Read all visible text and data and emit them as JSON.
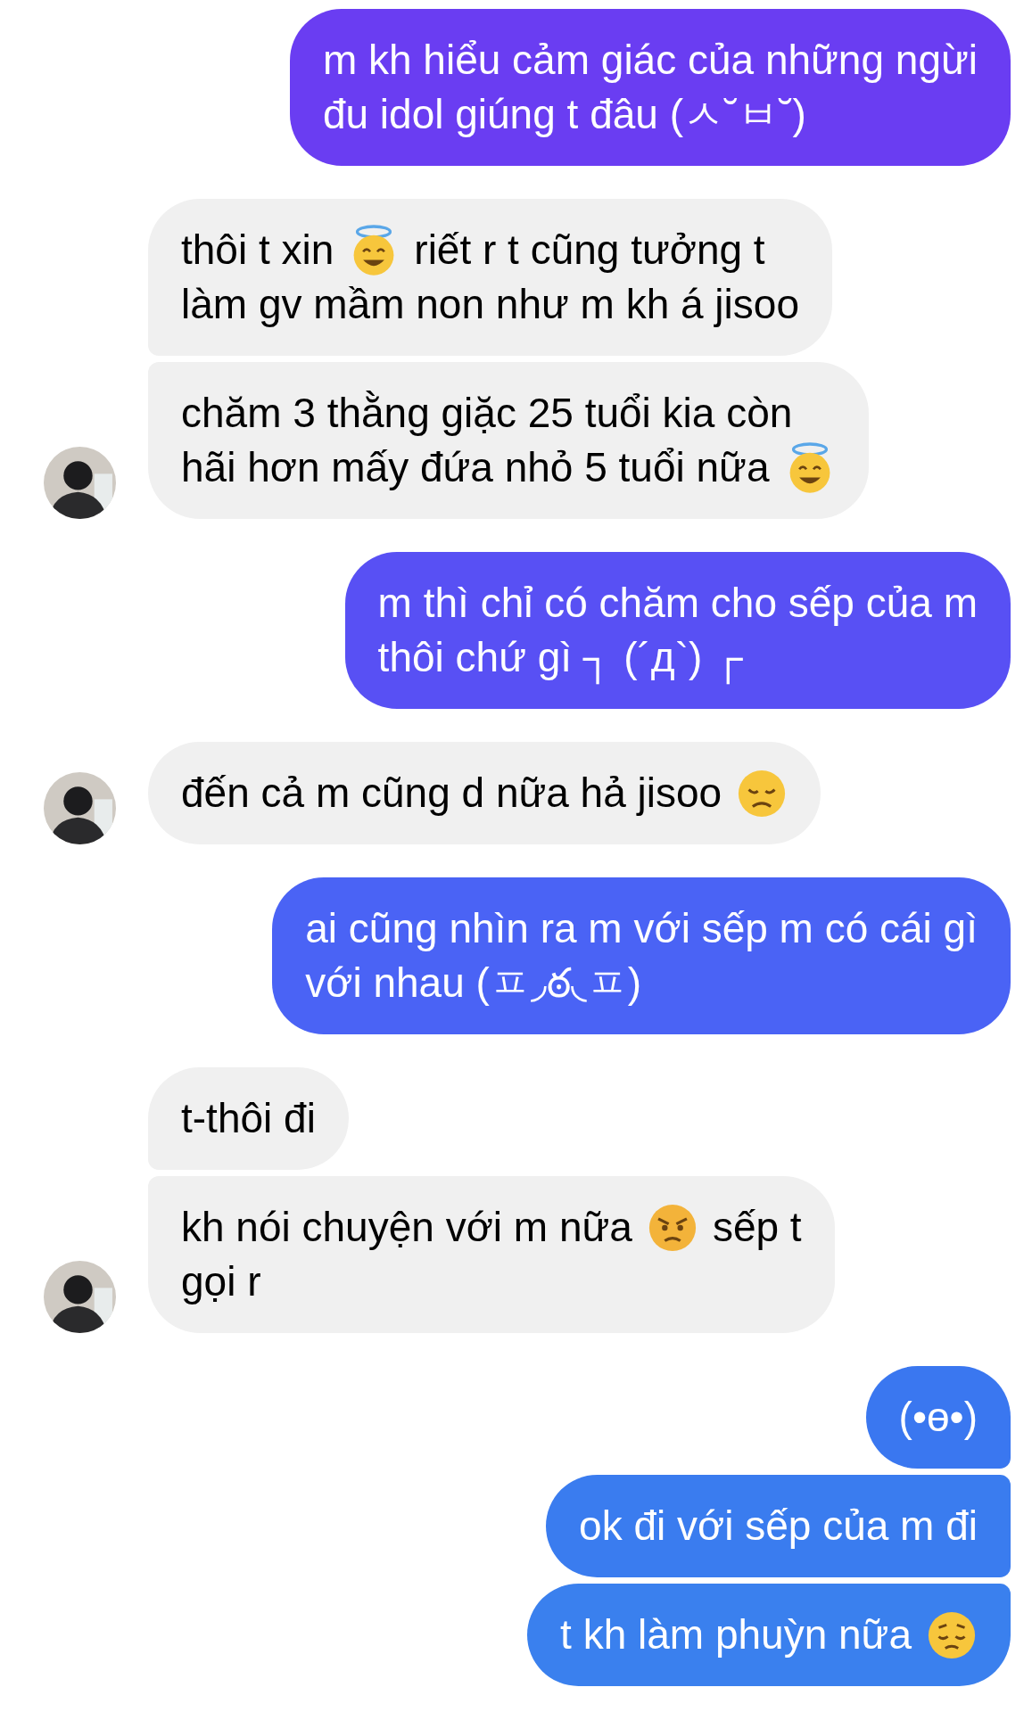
{
  "conversation": [
    {
      "outgoing": true,
      "messages": [
        {
          "lines": [
            [
              {
                "kind": "text",
                "text": "m kh hiểu cảm giác của những ngừi"
              }
            ],
            [
              {
                "kind": "text",
                "text": "đu idol giúng t đâu (ㅅ˘ㅂ˘)"
              }
            ]
          ]
        }
      ]
    },
    {
      "outgoing": false,
      "messages": [
        {
          "lines": [
            [
              {
                "kind": "text",
                "text": "thôi t xin"
              },
              {
                "kind": "halo-emoji"
              },
              {
                "kind": "text",
                "text": "riết r t cũng tưởng t"
              }
            ],
            [
              {
                "kind": "text",
                "text": "làm gv mầm non như m kh á jisoo"
              }
            ]
          ]
        },
        {
          "lines": [
            [
              {
                "kind": "text",
                "text": "chăm 3 thằng giặc 25 tuổi kia còn"
              }
            ],
            [
              {
                "kind": "text",
                "text": "hãi hơn mấy đứa nhỏ 5 tuổi nữa"
              },
              {
                "kind": "halo-emoji"
              }
            ]
          ]
        }
      ]
    },
    {
      "outgoing": true,
      "messages": [
        {
          "lines": [
            [
              {
                "kind": "text",
                "text": "m thì chỉ có chăm cho sếp của m"
              }
            ],
            [
              {
                "kind": "text",
                "text": "thôi chứ gì ┐ (´д`) ┌"
              }
            ]
          ]
        }
      ]
    },
    {
      "outgoing": false,
      "messages": [
        {
          "lines": [
            [
              {
                "kind": "text",
                "text": "đến cả m cũng d nữa hả jisoo"
              },
              {
                "kind": "sad-emoji"
              }
            ]
          ]
        }
      ]
    },
    {
      "outgoing": true,
      "messages": [
        {
          "lines": [
            [
              {
                "kind": "text",
                "text": "ai cũng nhìn ra m với sếp m có cái gì"
              }
            ],
            [
              {
                "kind": "text",
                "text": "với nhau (ㅍ◞ఠ◟ㅍ)"
              }
            ]
          ]
        }
      ]
    },
    {
      "outgoing": false,
      "messages": [
        {
          "lines": [
            [
              {
                "kind": "text",
                "text": "t-thôi đi"
              }
            ]
          ]
        },
        {
          "lines": [
            [
              {
                "kind": "text",
                "text": "kh nói chuyện với m nữa"
              },
              {
                "kind": "angry-emoji"
              },
              {
                "kind": "text",
                "text": "sếp t"
              }
            ],
            [
              {
                "kind": "text",
                "text": "gọi r"
              }
            ]
          ]
        }
      ]
    },
    {
      "outgoing": true,
      "messages": [
        {
          "lines": [
            [
              {
                "kind": "text",
                "text": "(•ө•)"
              }
            ]
          ]
        },
        {
          "lines": [
            [
              {
                "kind": "text",
                "text": "ok đi với sếp của m đi"
              }
            ]
          ]
        },
        {
          "lines": [
            [
              {
                "kind": "text",
                "text": "t kh làm phuỳn nữa"
              },
              {
                "kind": "pensive-emoji"
              }
            ]
          ]
        }
      ]
    }
  ]
}
